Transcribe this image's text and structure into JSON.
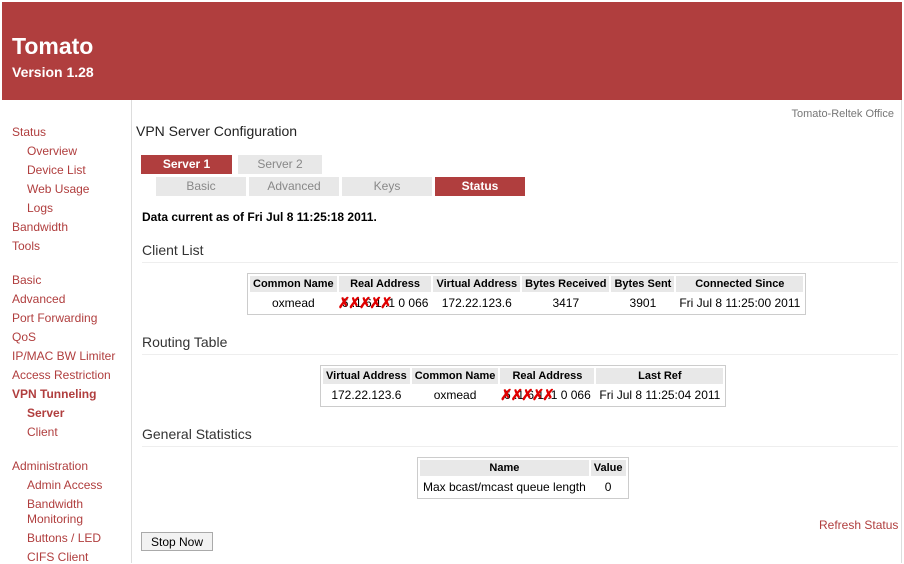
{
  "header": {
    "title": "Tomato",
    "version": "Version 1.28"
  },
  "router_name": "Tomato-Reltek Office",
  "sidebar": {
    "status": "Status",
    "overview": "Overview",
    "device_list": "Device List",
    "web_usage": "Web Usage",
    "logs": "Logs",
    "bandwidth": "Bandwidth",
    "tools": "Tools",
    "basic": "Basic",
    "advanced": "Advanced",
    "port_forwarding": "Port Forwarding",
    "qos": "QoS",
    "ipmac_bw_limiter": "IP/MAC BW Limiter",
    "access_restriction": "Access Restriction",
    "vpn_tunneling": "VPN Tunneling",
    "server": "Server",
    "client": "Client",
    "administration": "Administration",
    "admin_access": "Admin Access",
    "bandwidth_monitoring_1": "Bandwidth",
    "bandwidth_monitoring_2": "Monitoring",
    "buttons_led": "Buttons / LED",
    "cifs_client": "CIFS Client"
  },
  "page_title": "VPN Server Configuration",
  "server_tabs": {
    "server1": "Server 1",
    "server2": "Server 2"
  },
  "sub_tabs": {
    "basic": "Basic",
    "advanced": "Advanced",
    "keys": "Keys",
    "status": "Status"
  },
  "data_current": "Data current as of Fri Jul 8 11:25:18 2011.",
  "client_list": {
    "heading": "Client List",
    "columns": {
      "common_name": "Common Name",
      "real_address": "Real Address",
      "virtual_address": "Virtual Address",
      "bytes_received": "Bytes Received",
      "bytes_sent": "Bytes Sent",
      "connected_since": "Connected Since"
    },
    "row": {
      "common_name": "oxmead",
      "real_address": "6 .1 6 1 .1 0 066",
      "virtual_address": "172.22.123.6",
      "bytes_received": "3417",
      "bytes_sent": "3901",
      "connected_since": "Fri Jul 8 11:25:00 2011"
    }
  },
  "routing_table": {
    "heading": "Routing Table",
    "columns": {
      "virtual_address": "Virtual Address",
      "common_name": "Common Name",
      "real_address": "Real Address",
      "last_ref": "Last Ref"
    },
    "row": {
      "virtual_address": "172.22.123.6",
      "common_name": "oxmead",
      "real_address": "6 .1 6 1 .1 0 066",
      "last_ref": "Fri Jul 8 11:25:04 2011"
    }
  },
  "general_statistics": {
    "heading": "General Statistics",
    "columns": {
      "name": "Name",
      "value": "Value"
    },
    "row": {
      "name": "Max bcast/mcast queue length",
      "value": "0"
    }
  },
  "redaction_marks": "✗✗✗✗✗",
  "refresh_status": "Refresh Status",
  "stop_button": "Stop Now"
}
